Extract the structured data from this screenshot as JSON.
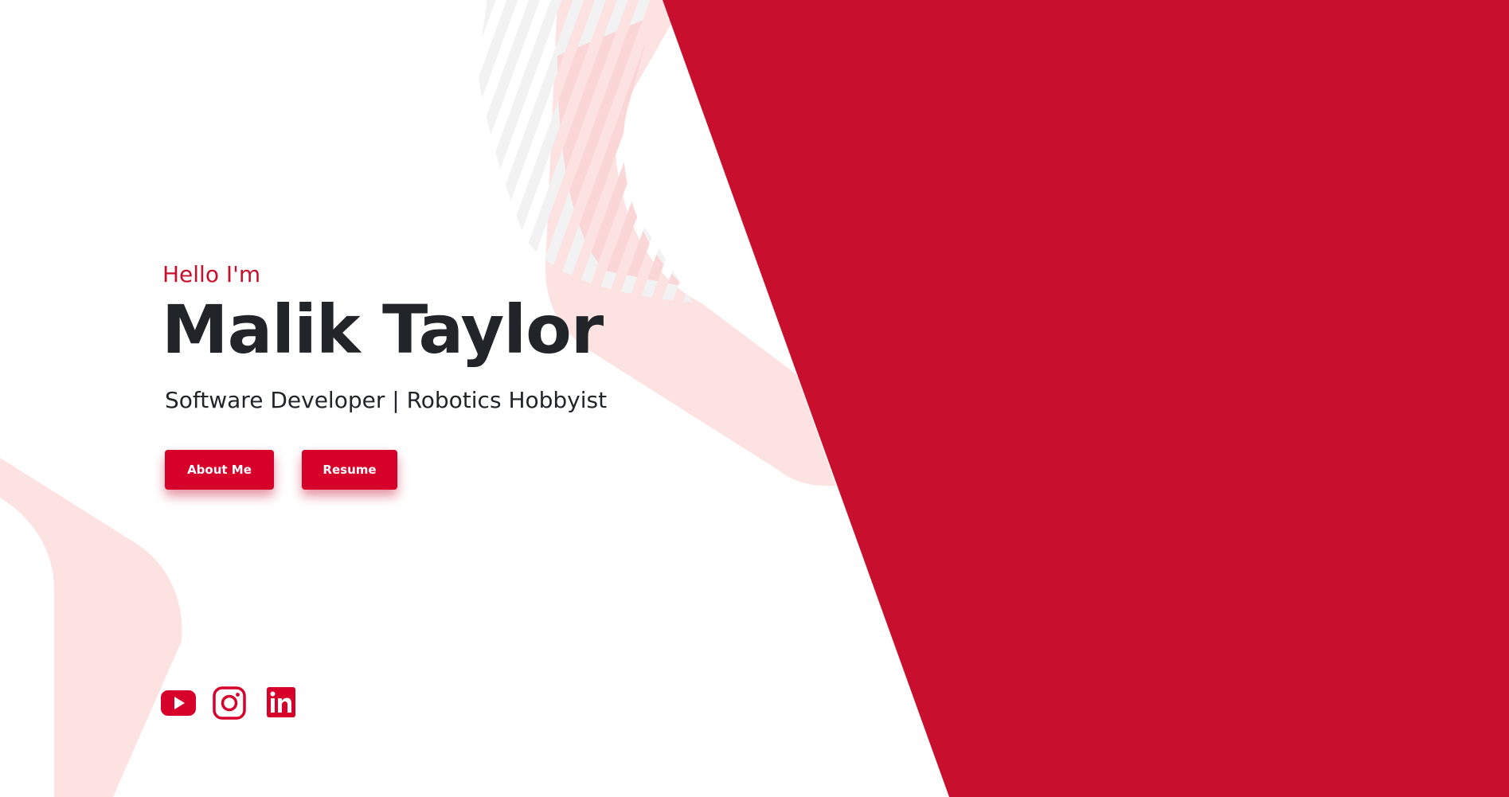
{
  "hero": {
    "greeting": "Hello I'm",
    "name": "Malik Taylor",
    "tagline": "Software Developer | Robotics Hobbyist"
  },
  "buttons": {
    "about_label": "About Me",
    "resume_label": "Resume"
  },
  "socials": [
    {
      "icon": "youtube-icon",
      "label": "YouTube"
    },
    {
      "icon": "instagram-icon",
      "label": "Instagram"
    },
    {
      "icon": "linkedin-icon",
      "label": "LinkedIn"
    }
  ],
  "colors": {
    "accent": "#c8102e",
    "button": "#d6002a",
    "text": "#212529",
    "decor_pink": "#fde2e2",
    "decor_stripe": "#f3f3f3",
    "background": "#ffffff"
  }
}
